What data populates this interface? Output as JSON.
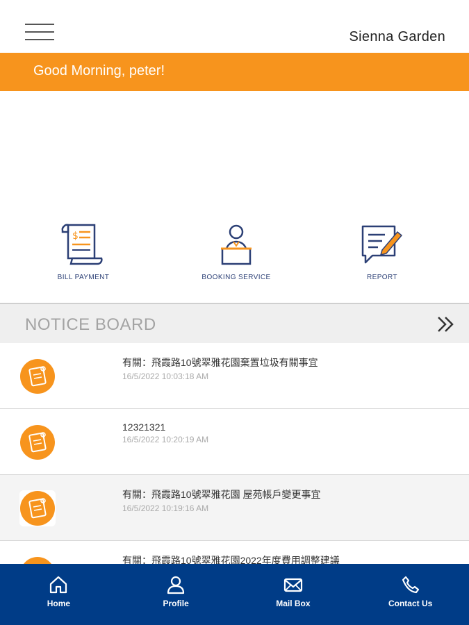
{
  "header": {
    "site_name": "Sienna Garden"
  },
  "banner": {
    "greeting": "Good Morning, peter!"
  },
  "services": [
    {
      "label": "BILL PAYMENT",
      "icon": "bill-icon"
    },
    {
      "label": "BOOKING SERVICE",
      "icon": "reception-icon"
    },
    {
      "label": "REPORT",
      "icon": "report-icon"
    }
  ],
  "notice_board": {
    "title": "NOTICE BOARD",
    "items": [
      {
        "title": "有關：飛霞路10號翠雅花園棄置垃圾有關事宜",
        "date": "16/5/2022 10:03:18 AM"
      },
      {
        "title": "12321321",
        "date": "16/5/2022 10:20:19 AM"
      },
      {
        "title": "有關：飛霞路10號翠雅花園 屋苑帳戶變更事宜",
        "date": "16/5/2022 10:19:16 AM"
      },
      {
        "title": "有關：飛霞路10號翠雅花園2022年度費用調整建議",
        "date": ""
      }
    ]
  },
  "bottom_nav": [
    {
      "label": "Home",
      "icon": "home-icon"
    },
    {
      "label": "Profile",
      "icon": "profile-icon"
    },
    {
      "label": "Mail Box",
      "icon": "mail-icon"
    },
    {
      "label": "Contact Us",
      "icon": "phone-icon"
    }
  ],
  "colors": {
    "accent": "#f7941d",
    "nav": "#003c87",
    "icon_blue": "#2b3f75"
  }
}
